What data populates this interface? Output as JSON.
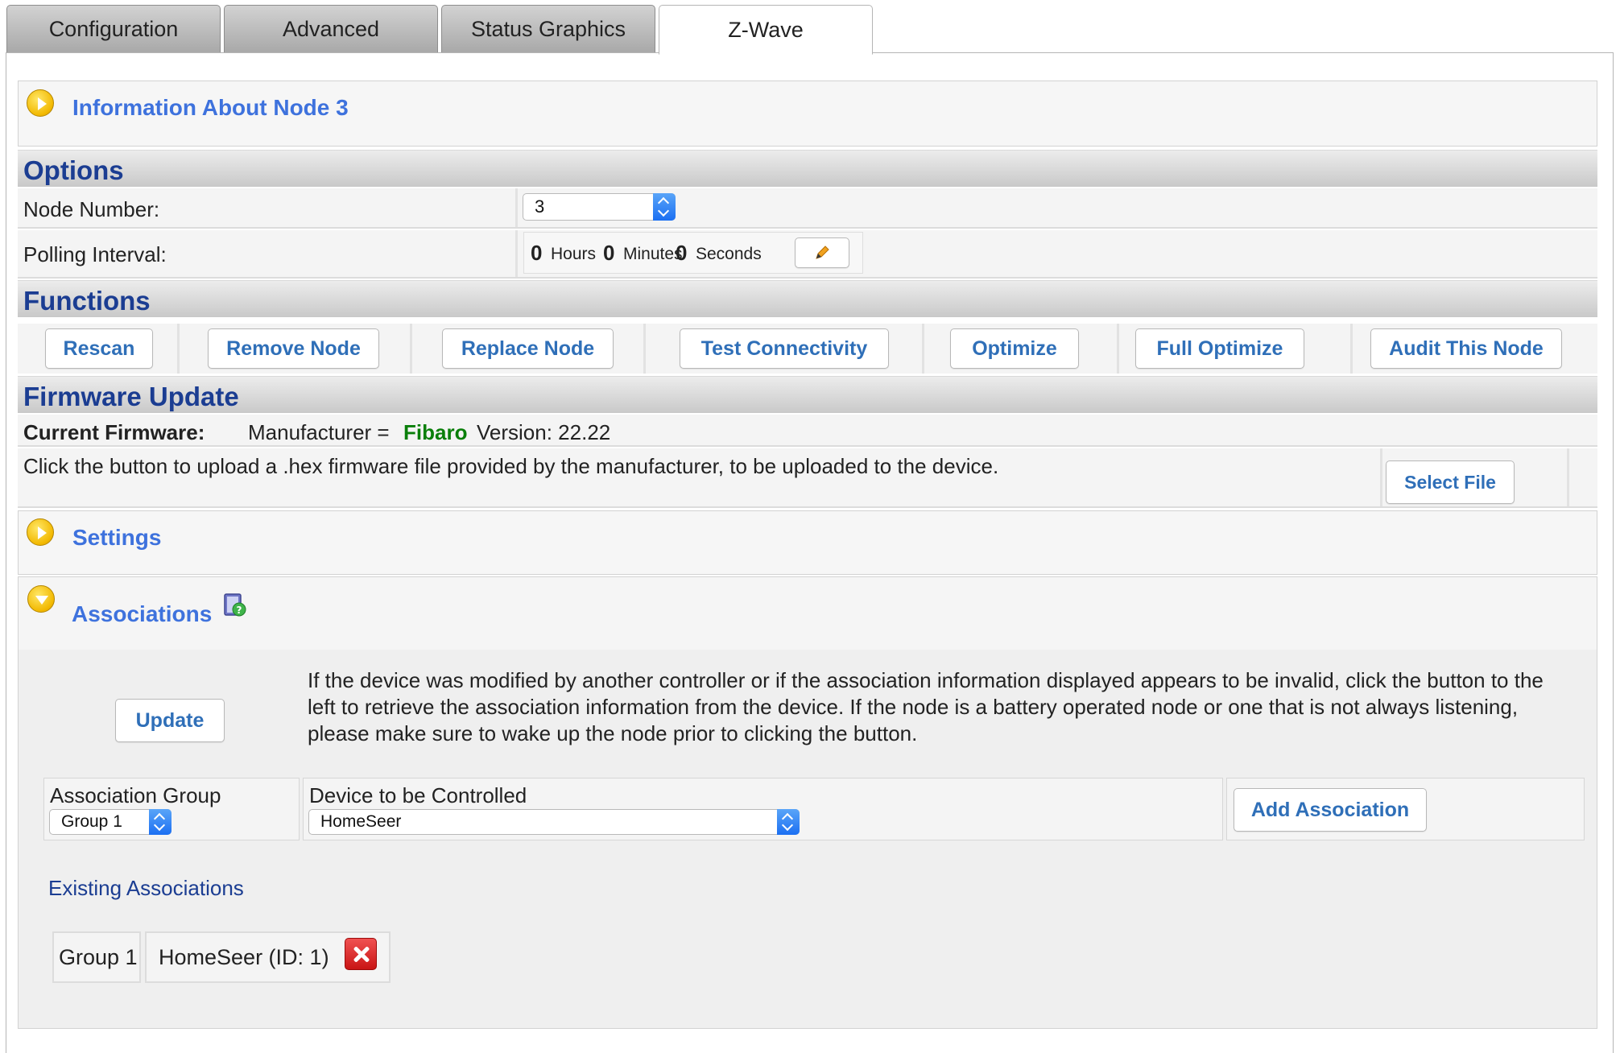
{
  "tabs": [
    {
      "label": "Configuration"
    },
    {
      "label": "Advanced"
    },
    {
      "label": "Status Graphics"
    },
    {
      "label": "Z-Wave"
    }
  ],
  "info_section": {
    "title": "Information About Node 3"
  },
  "options": {
    "title": "Options",
    "node_number_label": "Node Number:",
    "node_number_value": "3",
    "polling_label": "Polling Interval:",
    "polling": {
      "hours": "0",
      "hours_label": "Hours",
      "minutes": "0",
      "minutes_label": "Minutes",
      "seconds": "0",
      "seconds_label": "Seconds"
    }
  },
  "functions": {
    "title": "Functions",
    "buttons": [
      "Rescan",
      "Remove Node",
      "Replace Node",
      "Test Connectivity",
      "Optimize",
      "Full Optimize",
      "Audit This Node"
    ]
  },
  "firmware": {
    "title": "Firmware Update",
    "current_label": "Current Firmware:",
    "manufacturer_prefix": "Manufacturer =",
    "manufacturer": "Fibaro",
    "version_text": "Version: 22.22",
    "instructions": "Click the button to upload a .hex firmware file provided by the manufacturer, to be uploaded to the device.",
    "select_file_label": "Select File"
  },
  "settings_section": {
    "title": "Settings"
  },
  "associations": {
    "title": "Associations",
    "update_label": "Update",
    "description": "If the device was modified by another controller or if the association information displayed appears to be invalid, click the button to the left to retrieve the association information from the device. If the node is a battery operated node or one that is not always listening, please make sure to wake up the node prior to clicking the button.",
    "group_header": "Association Group",
    "group_value": "Group 1",
    "device_header": "Device to be Controlled",
    "device_value": "HomeSeer",
    "add_label": "Add Association",
    "existing_title": "Existing Associations",
    "existing": [
      {
        "group": "Group 1",
        "device": "HomeSeer (ID: 1)"
      }
    ]
  },
  "colors": {
    "accent_blue": "#3e72dd",
    "heading_navy": "#1b3d92",
    "button_text": "#2f6fb8",
    "manufacturer_green": "#0a7f0a",
    "delete_red": "#d32020"
  }
}
